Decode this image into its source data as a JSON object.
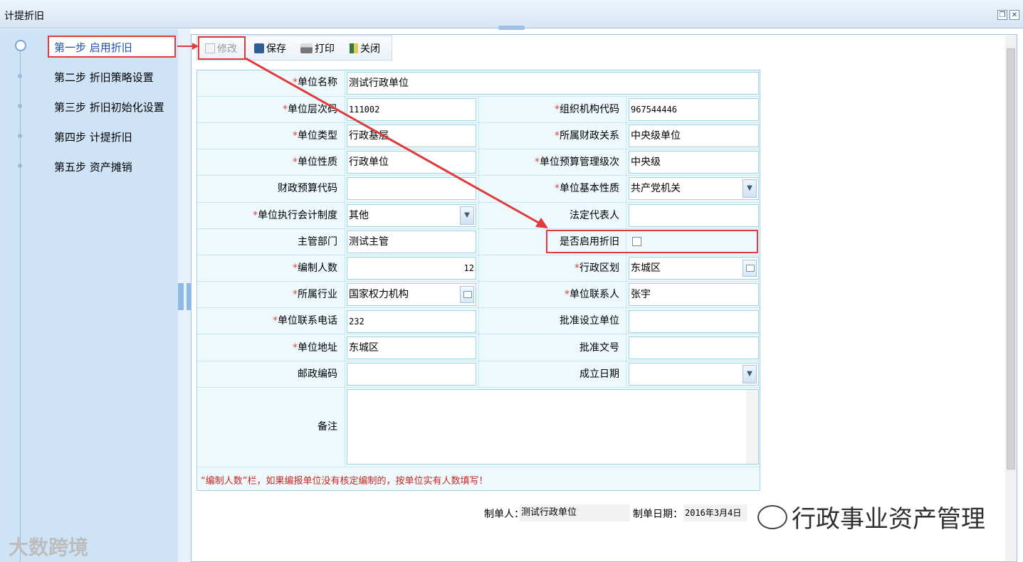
{
  "window": {
    "title": "计提折旧"
  },
  "steps": [
    {
      "label": "第一步 启用折旧",
      "active": true
    },
    {
      "label": "第二步 折旧策略设置"
    },
    {
      "label": "第三步 折旧初始化设置"
    },
    {
      "label": "第四步 计提折旧"
    },
    {
      "label": "第五步 资产摊销"
    }
  ],
  "toolbar": {
    "modify": "修改",
    "save": "保存",
    "print": "打印",
    "close": "关闭"
  },
  "form": {
    "unit_name": {
      "label": "单位名称",
      "value": "测试行政单位"
    },
    "unit_code": {
      "label": "单位层次码",
      "value": "111002"
    },
    "org_code": {
      "label": "组织机构代码",
      "value": "967544446"
    },
    "unit_type": {
      "label": "单位类型",
      "value": "行政基层"
    },
    "finance_rel": {
      "label": "所属财政关系",
      "value": "中央级单位"
    },
    "unit_nature": {
      "label": "单位性质",
      "value": "行政单位"
    },
    "budget_level": {
      "label": "单位预算管理级次",
      "value": "中央级"
    },
    "budget_code": {
      "label": "财政预算代码",
      "value": ""
    },
    "basic_nature": {
      "label": "单位基本性质",
      "value": "共产党机关"
    },
    "accounting": {
      "label": "单位执行会计制度",
      "value": "其他"
    },
    "legal_rep": {
      "label": "法定代表人",
      "value": ""
    },
    "dept": {
      "label": "主管部门",
      "value": "测试主管"
    },
    "enable_dep": {
      "label": "是否启用折旧",
      "checked": false
    },
    "staff": {
      "label": "编制人数",
      "value": "12"
    },
    "district": {
      "label": "行政区划",
      "value": "东城区"
    },
    "industry": {
      "label": "所属行业",
      "value": "国家权力机构"
    },
    "contact": {
      "label": "单位联系人",
      "value": "张宇"
    },
    "phone": {
      "label": "单位联系电话",
      "value": "232"
    },
    "approve_unit": {
      "label": "批准设立单位",
      "value": ""
    },
    "address": {
      "label": "单位地址",
      "value": "东城区"
    },
    "approve_doc": {
      "label": "批准文号",
      "value": ""
    },
    "postcode": {
      "label": "邮政编码",
      "value": ""
    },
    "found_date": {
      "label": "成立日期",
      "value": ""
    },
    "remark": {
      "label": "备注",
      "value": ""
    },
    "note": "“编制人数”栏，如果编报单位没有核定编制的，按单位实有人数填写！"
  },
  "footer": {
    "maker_label": "制单人：",
    "maker_value": "测试行政单位",
    "date_label": "制单日期：",
    "date_value": "2016年3月4日"
  },
  "watermarks": {
    "left": "大数跨境",
    "right": "行政事业资产管理"
  },
  "colors": {
    "highlight": "#e03a3a",
    "required_star": "#e0473a",
    "panel_bg": "#cfe3f7"
  }
}
